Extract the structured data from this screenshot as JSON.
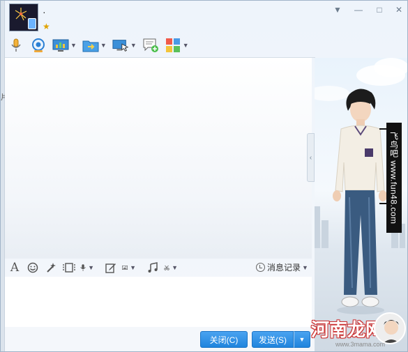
{
  "window": {
    "contact_name": "·",
    "controls": {
      "menu": "▼",
      "minimize": "—",
      "maximize": "□",
      "close": "✕"
    }
  },
  "top_toolbar": {
    "items": [
      {
        "icon": "microphone-icon",
        "has_dropdown": false
      },
      {
        "icon": "webcam-icon",
        "has_dropdown": false
      },
      {
        "icon": "app-share-icon",
        "has_dropdown": true
      },
      {
        "icon": "file-transfer-icon",
        "has_dropdown": true
      },
      {
        "icon": "remote-desktop-icon",
        "has_dropdown": true
      },
      {
        "icon": "create-discussion-icon",
        "has_dropdown": false
      },
      {
        "icon": "apps-grid-icon",
        "has_dropdown": true
      }
    ]
  },
  "input_toolbar": {
    "icons": [
      "font-icon",
      "emoji-icon",
      "magic-wand-icon",
      "film-icon",
      "voice-icon",
      "edit-icon",
      "image-icon",
      "music-icon",
      "scissors-icon"
    ],
    "history_label": "消息记录"
  },
  "buttons": {
    "close_label": "关闭(C)",
    "send_label": "发送(S)",
    "send_arrow": "▼"
  },
  "side_panel": {
    "watermark_vertical": "飞鸟吧 www.fun48.com",
    "watermark_logo": "河南龙网",
    "watermark_url": "www.3mama.com"
  },
  "left_edge_glyph": "片",
  "colors": {
    "button_blue": "#1f84dd",
    "panel_bg": "#eef4fb",
    "star": "#e0a300"
  }
}
